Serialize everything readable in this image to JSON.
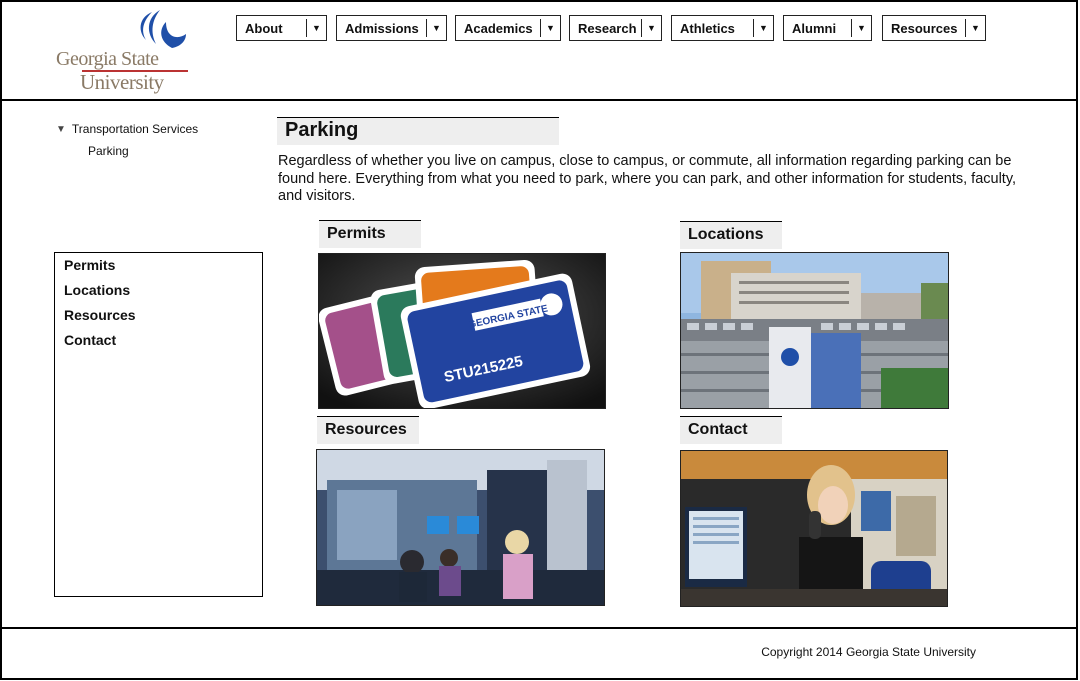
{
  "logo": {
    "line1": "Georgia State",
    "line2": "University"
  },
  "nav": [
    {
      "label": "About"
    },
    {
      "label": "Admissions"
    },
    {
      "label": "Academics"
    },
    {
      "label": "Research"
    },
    {
      "label": "Athletics"
    },
    {
      "label": "Alumni"
    },
    {
      "label": "Resources"
    }
  ],
  "tree": {
    "root": "Transportation Services",
    "child": "Parking"
  },
  "side_menu": [
    "Permits",
    "Locations",
    "Resources",
    "Contact"
  ],
  "page": {
    "title": "Parking",
    "intro": "Regardless of whether you live on campus, close to campus, or commute, all information regarding parking can be found here. Everything from what you need to park, where you can park, and other information for students, faculty, and visitors."
  },
  "cards": {
    "permits": {
      "title": "Permits",
      "permit_text": "STU215225",
      "permit_brand": "GEORGIA STATE"
    },
    "locations": {
      "title": "Locations"
    },
    "resources": {
      "title": "Resources"
    },
    "contact": {
      "title": "Contact"
    }
  },
  "footer": {
    "copyright": "Copyright 2014 Georgia State University"
  },
  "colors": {
    "brand_blue": "#1f4fa8",
    "logo_brown": "#8a7a66",
    "title_bg": "#eeeeee"
  }
}
